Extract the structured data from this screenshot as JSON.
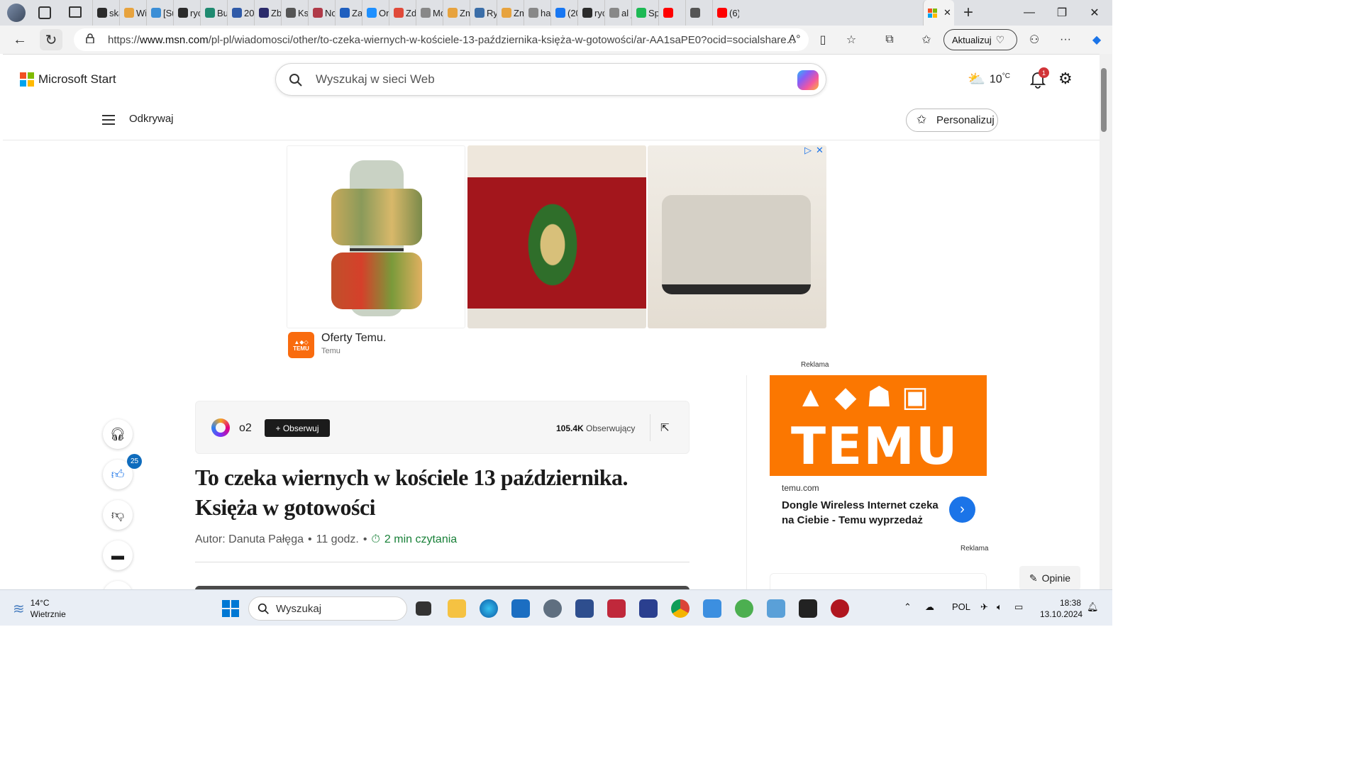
{
  "browser": {
    "tabs": [
      {
        "label": "ska",
        "color": "#2b2b2b"
      },
      {
        "label": "Wi",
        "color": "#e7a33e"
      },
      {
        "label": "[Su",
        "color": "#3b8ed6"
      },
      {
        "label": "ryc",
        "color": "#2b2b2b"
      },
      {
        "label": "Bui",
        "color": "#1f8a70"
      },
      {
        "label": "202",
        "color": "#2f5aa8"
      },
      {
        "label": "Zbi",
        "color": "#2b2b6b"
      },
      {
        "label": "Ksi",
        "color": "#555555"
      },
      {
        "label": "No",
        "color": "#b03a48"
      },
      {
        "label": "Zal",
        "color": "#1f5fbf"
      },
      {
        "label": "On",
        "color": "#1e90ff"
      },
      {
        "label": "Zdj",
        "color": "#e04a3a"
      },
      {
        "label": "Mc",
        "color": "#888888"
      },
      {
        "label": "Zm",
        "color": "#e7a33e"
      },
      {
        "label": "Ry",
        "color": "#3b6ea8"
      },
      {
        "label": "Zm",
        "color": "#e7a33e"
      },
      {
        "label": "ha",
        "color": "#888888"
      },
      {
        "label": "(20",
        "color": "#1877f2"
      },
      {
        "label": "ryc",
        "color": "#2b2b2b"
      },
      {
        "label": "al j",
        "color": "#888888"
      },
      {
        "label": "Sp",
        "color": "#1db954"
      },
      {
        "label": "",
        "color": "#ff0000"
      },
      {
        "label": "",
        "color": "#555555"
      },
      {
        "label": "(6)",
        "color": "#ff0000"
      }
    ],
    "url_prefix": "https://",
    "url_host": "www.msn.com",
    "url_path": "/pl-pl/wiadomosci/other/to-czeka-wiernych-w-kościele-13-października-księża-w-gotowości/ar-AA1saPE0?ocid=socialshare...",
    "update_label": "Aktualizuj"
  },
  "header": {
    "logo_text": "Microsoft Start",
    "search_placeholder": "Wyszukaj w sieci Web",
    "temperature": "10",
    "temp_unit": "°C",
    "notification_count": "1",
    "discover_label": "Odkrywaj",
    "personalize_label": "Personalizuj"
  },
  "ad_top": {
    "title": "Oferty Temu.",
    "source": "Temu",
    "logo_text": "TEMU"
  },
  "ad_right": {
    "label_top": "Reklama",
    "brand": "TEMU",
    "domain": "temu.com",
    "text": "Dongle Wireless Internet czeka na Ciebie - Temu wyprzedaż",
    "label_bottom": "Reklama"
  },
  "article": {
    "source_name": "o2",
    "follow_label": "+ Obserwuj",
    "followers_count": "105.4K",
    "followers_label": "Obserwujący",
    "headline": "To czeka wiernych w kościele 13 października. Księża w gotowości",
    "author": "Autor: Danuta Pałęga",
    "time": "11 godz.",
    "read_time": "2 min czytania",
    "like_count": "25"
  },
  "feedback_label": "Opinie",
  "taskbar": {
    "weather_temp": "14°C",
    "weather_desc": "Wietrznie",
    "search_placeholder": "Wyszukaj",
    "language": "POL",
    "time": "18:38",
    "date": "13.10.2024"
  }
}
